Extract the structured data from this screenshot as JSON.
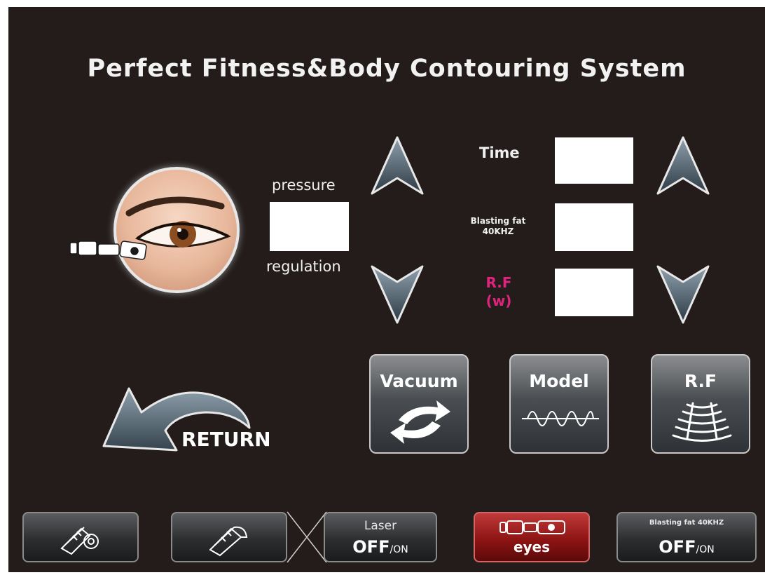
{
  "title": "Perfect Fitness&Body Contouring System",
  "pressure": {
    "label_top": "pressure",
    "label_bottom": "regulation",
    "value": ""
  },
  "params": {
    "time_label": "Time",
    "time_value": "",
    "blasting_label_line1": "Blasting fat",
    "blasting_label_line2": "40KHZ",
    "blasting_value": "",
    "rf_label_line1": "R.F",
    "rf_label_line2": "(w)",
    "rf_value": ""
  },
  "features": {
    "vacuum": "Vacuum",
    "model": "Model",
    "rf": "R.F"
  },
  "return_label": "RETURN",
  "bottom_bar": {
    "laser_top": "Laser",
    "laser_off": "OFF",
    "laser_on": "/ON",
    "eyes_label": "eyes",
    "blast_top": "Blasting fat 40KHZ",
    "blast_off": "OFF",
    "blast_on": "/ON"
  },
  "colors": {
    "background": "#231c1b",
    "rf_accent": "#e0237c",
    "active_button": "#8e1414"
  }
}
